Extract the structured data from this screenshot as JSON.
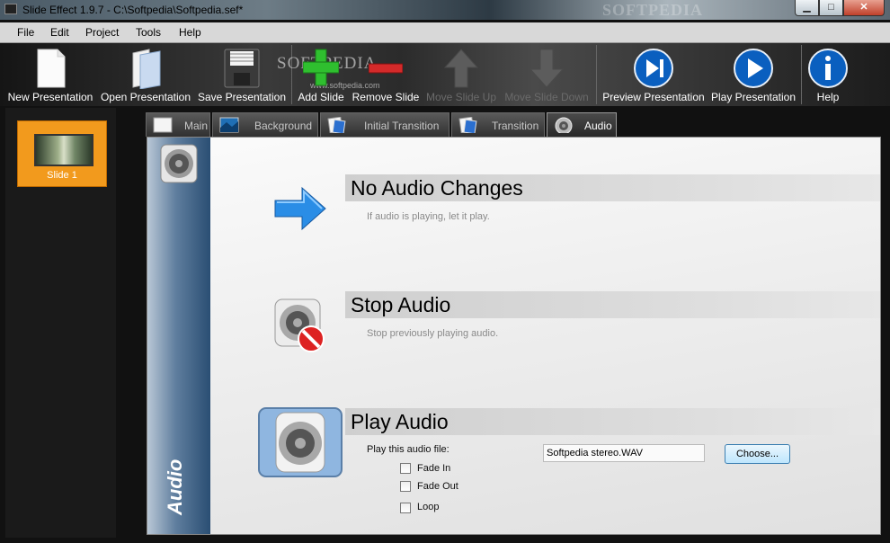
{
  "window": {
    "title": "Slide Effect 1.9.7 - C:\\Softpedia\\Softpedia.sef*",
    "watermark": "SOFTPEDIA",
    "min_glyph": "▁",
    "max_glyph": "□",
    "close_glyph": "✕"
  },
  "menu": {
    "items": [
      {
        "label": "File"
      },
      {
        "label": "Edit"
      },
      {
        "label": "Project"
      },
      {
        "label": "Tools"
      },
      {
        "label": "Help"
      }
    ]
  },
  "toolbar": {
    "new_presentation": "New Presentation",
    "open_presentation": "Open Presentation",
    "save_presentation": "Save Presentation",
    "add_slide": "Add Slide",
    "remove_slide": "Remove Slide",
    "move_slide_up": "Move Slide Up",
    "move_slide_down": "Move Slide Down",
    "preview_presentation": "Preview Presentation",
    "play_presentation": "Play Presentation",
    "help": "Help",
    "watermark": "SOFTPEDIA",
    "watermark_url": "www.softpedia.com"
  },
  "slides": {
    "items": [
      {
        "label": "Slide 1",
        "selected": true
      }
    ]
  },
  "tabs": {
    "items": [
      {
        "label": "Main"
      },
      {
        "label": "Background"
      },
      {
        "label": "Initial Transition"
      },
      {
        "label": "Transition"
      },
      {
        "label": "Audio",
        "active": true
      }
    ]
  },
  "audio": {
    "side_title": "Audio",
    "options": [
      {
        "title": "No Audio Changes",
        "desc": "If audio is playing, let it play."
      },
      {
        "title": "Stop Audio",
        "desc": "Stop previously playing audio."
      },
      {
        "title": "Play Audio",
        "desc": ""
      }
    ],
    "play_label": "Play this audio file:",
    "file_value": "Softpedia stereo.WAV",
    "choose_label": "Choose...",
    "fade_in": "Fade In",
    "fade_out": "Fade Out",
    "loop": "Loop",
    "fade_in_checked": false,
    "fade_out_checked": false,
    "loop_checked": false
  },
  "colors": {
    "accent_blue": "#0a5fbf",
    "slide_selected": "#f29a1d",
    "add_green": "#2fbf2f",
    "remove_red": "#d42a2a"
  }
}
